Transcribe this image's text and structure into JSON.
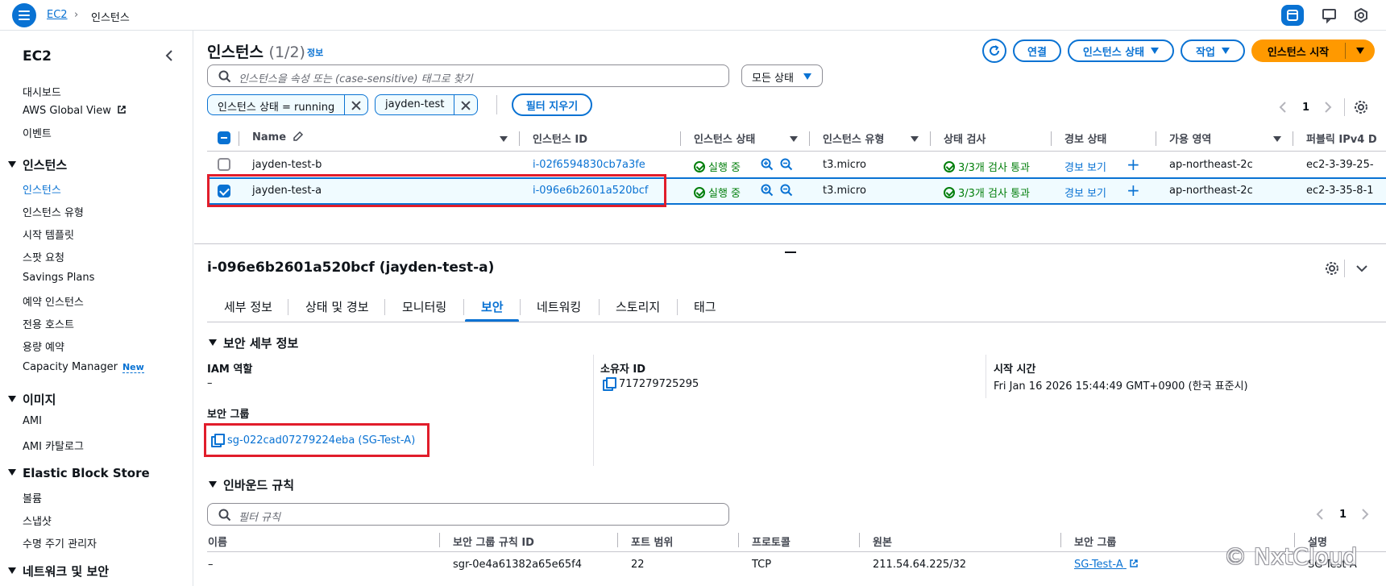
{
  "topbar": {
    "breadcrumb_service": "EC2",
    "breadcrumb_sep": "›",
    "breadcrumb_page": "인스턴스"
  },
  "sidebar": {
    "title": "EC2",
    "top_items": [
      "대시보드",
      "AWS Global View",
      "이벤트"
    ],
    "sections": [
      {
        "label": "인스턴스",
        "items": [
          "인스턴스",
          "인스턴스 유형",
          "시작 템플릿",
          "스팟 요청",
          "Savings Plans",
          "예약 인스턴스",
          "전용 호스트",
          "용량 예약",
          "Capacity Manager"
        ],
        "active": "인스턴스"
      },
      {
        "label": "이미지",
        "items": [
          "AMI",
          "AMI 카탈로그"
        ]
      },
      {
        "label": "Elastic Block Store",
        "items": [
          "볼륨",
          "스냅샷",
          "수명 주기 관리자"
        ]
      },
      {
        "label": "네트워크 및 보안",
        "items": []
      }
    ],
    "new_badge": "New"
  },
  "header": {
    "title": "인스턴스",
    "count": "(1/2)",
    "info_link": "정보",
    "btn_connect": "연결",
    "btn_state": "인스턴스 상태",
    "btn_actions": "작업",
    "btn_launch": "인스턴스 시작"
  },
  "filters": {
    "search_placeholder": "인스턴스을 속성 또는 (case-sensitive) 태그로 찾기",
    "state_select": "모든 상태",
    "tokens": [
      "인스턴스 상태 = running",
      "jayden-test"
    ],
    "clear_filters": "필터 지우기",
    "page": "1"
  },
  "table": {
    "columns": [
      "Name",
      "인스턴스 ID",
      "인스턴스 상태",
      "인스턴스 유형",
      "상태 검사",
      "경보 상태",
      "가용 영역",
      "퍼블릭 IPv4 D"
    ],
    "rows": [
      {
        "name": "jayden-test-b",
        "id": "i-02f6594830cb7a3fe",
        "state": "실행 중",
        "type": "t3.micro",
        "check": "3/3개 검사 통과",
        "alarm": "경보 보기",
        "alarm_add": "+",
        "az": "ap-northeast-2c",
        "dns": "ec2-3-39-25-",
        "selected": false
      },
      {
        "name": "jayden-test-a",
        "id": "i-096e6b2601a520bcf",
        "state": "실행 중",
        "type": "t3.micro",
        "check": "3/3개 검사 통과",
        "alarm": "경보 보기",
        "alarm_add": "+",
        "az": "ap-northeast-2c",
        "dns": "ec2-3-35-8-1",
        "selected": true
      }
    ]
  },
  "details": {
    "title": "i-096e6b2601a520bcf (jayden-test-a)",
    "tabs": [
      "세부 정보",
      "상태 및 경보",
      "모니터링",
      "보안",
      "네트워킹",
      "스토리지",
      "태그"
    ],
    "active_tab": "보안",
    "security_section": "보안 세부 정보",
    "iam_label": "IAM 역할",
    "iam_value": "–",
    "owner_label": "소유자 ID",
    "owner_value": "717279725295",
    "launch_label": "시작 시간",
    "launch_value": "Fri Jan 16 2026 15:44:49 GMT+0900 (한국 표준시)",
    "sg_label": "보안 그룹",
    "sg_value": "sg-022cad07279224eba (SG-Test-A)",
    "inbound_section": "인바운드 규칙",
    "inbound_placeholder": "필터 규칙",
    "inbound_page": "1",
    "inbound_columns": [
      "이름",
      "보안 그룹 규칙 ID",
      "포트 범위",
      "프로토콜",
      "원본",
      "보안 그룹",
      "설명"
    ],
    "inbound_row": {
      "name": "–",
      "rule_id": "sgr-0e4a61382a65e65f4",
      "port": "22",
      "protocol": "TCP",
      "source": "211.54.64.225/32",
      "sg": "SG-Test-A",
      "desc": "SG-Test-A"
    }
  },
  "watermark": "© NxtCloud",
  "colors": {
    "accent": "#0972d3",
    "launch": "#ff9900",
    "success": "#037f0c",
    "highlight": "#e11d2b"
  }
}
